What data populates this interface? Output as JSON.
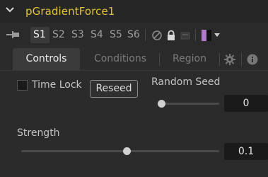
{
  "header": {
    "title": "pGradientForce1"
  },
  "toolbar": {
    "slots": [
      "S1",
      "S2",
      "S3",
      "S4",
      "S5",
      "S6"
    ],
    "active_slot": "S1",
    "color_swatch": "#b07ac8"
  },
  "tabs": [
    {
      "label": "Controls",
      "active": true
    },
    {
      "label": "Conditions",
      "active": false
    },
    {
      "label": "Region",
      "active": false
    }
  ],
  "controls": {
    "time_lock_label": "Time Lock",
    "time_lock_checked": false,
    "reseed_label": "Reseed",
    "random_seed_label": "Random Seed",
    "random_seed_value": "0",
    "strength_label": "Strength",
    "strength_value": "0.1"
  },
  "colors": {
    "title": "#e3c33b",
    "background": "#2b2b2b"
  }
}
